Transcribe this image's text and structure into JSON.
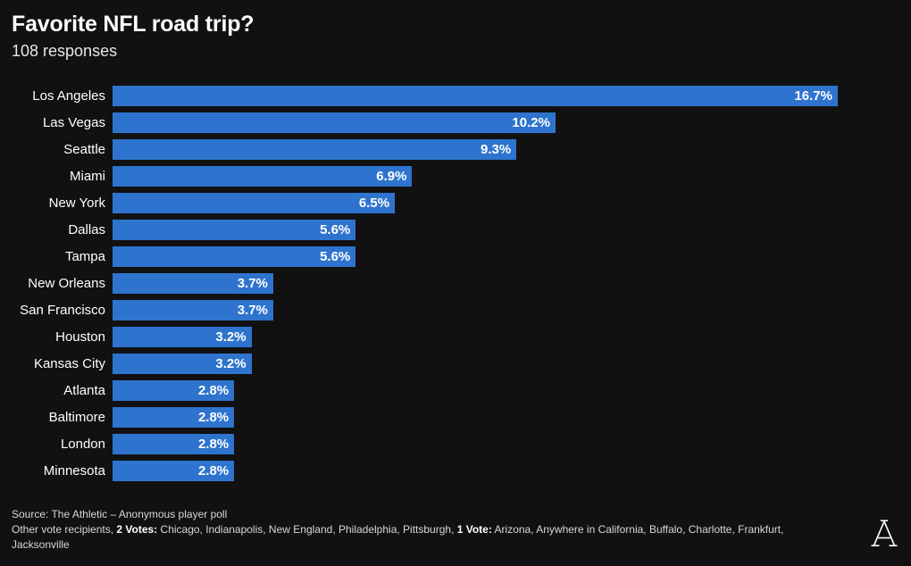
{
  "header": {
    "title": "Favorite NFL road trip?",
    "subtitle": "108 responses"
  },
  "footer": {
    "source": "Source: The Athletic – Anonymous player poll",
    "other_votes_prefix": "Other vote recipients, ",
    "two_votes_label": "2 Votes:",
    "two_votes_list": " Chicago, Indianapolis, New England, Philadelphia, Pittsburgh, ",
    "one_vote_label": "1 Vote:",
    "one_vote_list": " Arizona, Anywhere in California, Buffalo, Charlotte, Frankfurt, Jacksonville",
    "logo_name": "the-athletic-a-logo"
  },
  "colors": {
    "background": "#111111",
    "bar": "#2e74ce",
    "text": "#ffffff",
    "muted_text": "#d8d8d8"
  },
  "chart_data": {
    "type": "bar",
    "orientation": "horizontal",
    "title": "Favorite NFL road trip?",
    "subtitle": "108 responses",
    "xlabel": "",
    "ylabel": "",
    "xlim": [
      0,
      16.7
    ],
    "grid": false,
    "legend": false,
    "value_suffix": "%",
    "categories": [
      "Los Angeles",
      "Las Vegas",
      "Seattle",
      "Miami",
      "New York",
      "Dallas",
      "Tampa",
      "New Orleans",
      "San Francisco",
      "Houston",
      "Kansas City",
      "Atlanta",
      "Baltimore",
      "London",
      "Minnesota"
    ],
    "values": [
      16.7,
      10.2,
      9.3,
      6.9,
      6.5,
      5.6,
      5.6,
      3.7,
      3.7,
      3.2,
      3.2,
      2.8,
      2.8,
      2.8,
      2.8
    ],
    "labels": [
      "16.7%",
      "10.2%",
      "9.3%",
      "6.9%",
      "6.5%",
      "5.6%",
      "5.6%",
      "3.7%",
      "3.7%",
      "3.2%",
      "3.2%",
      "2.8%",
      "2.8%",
      "2.8%",
      "2.8%"
    ]
  }
}
